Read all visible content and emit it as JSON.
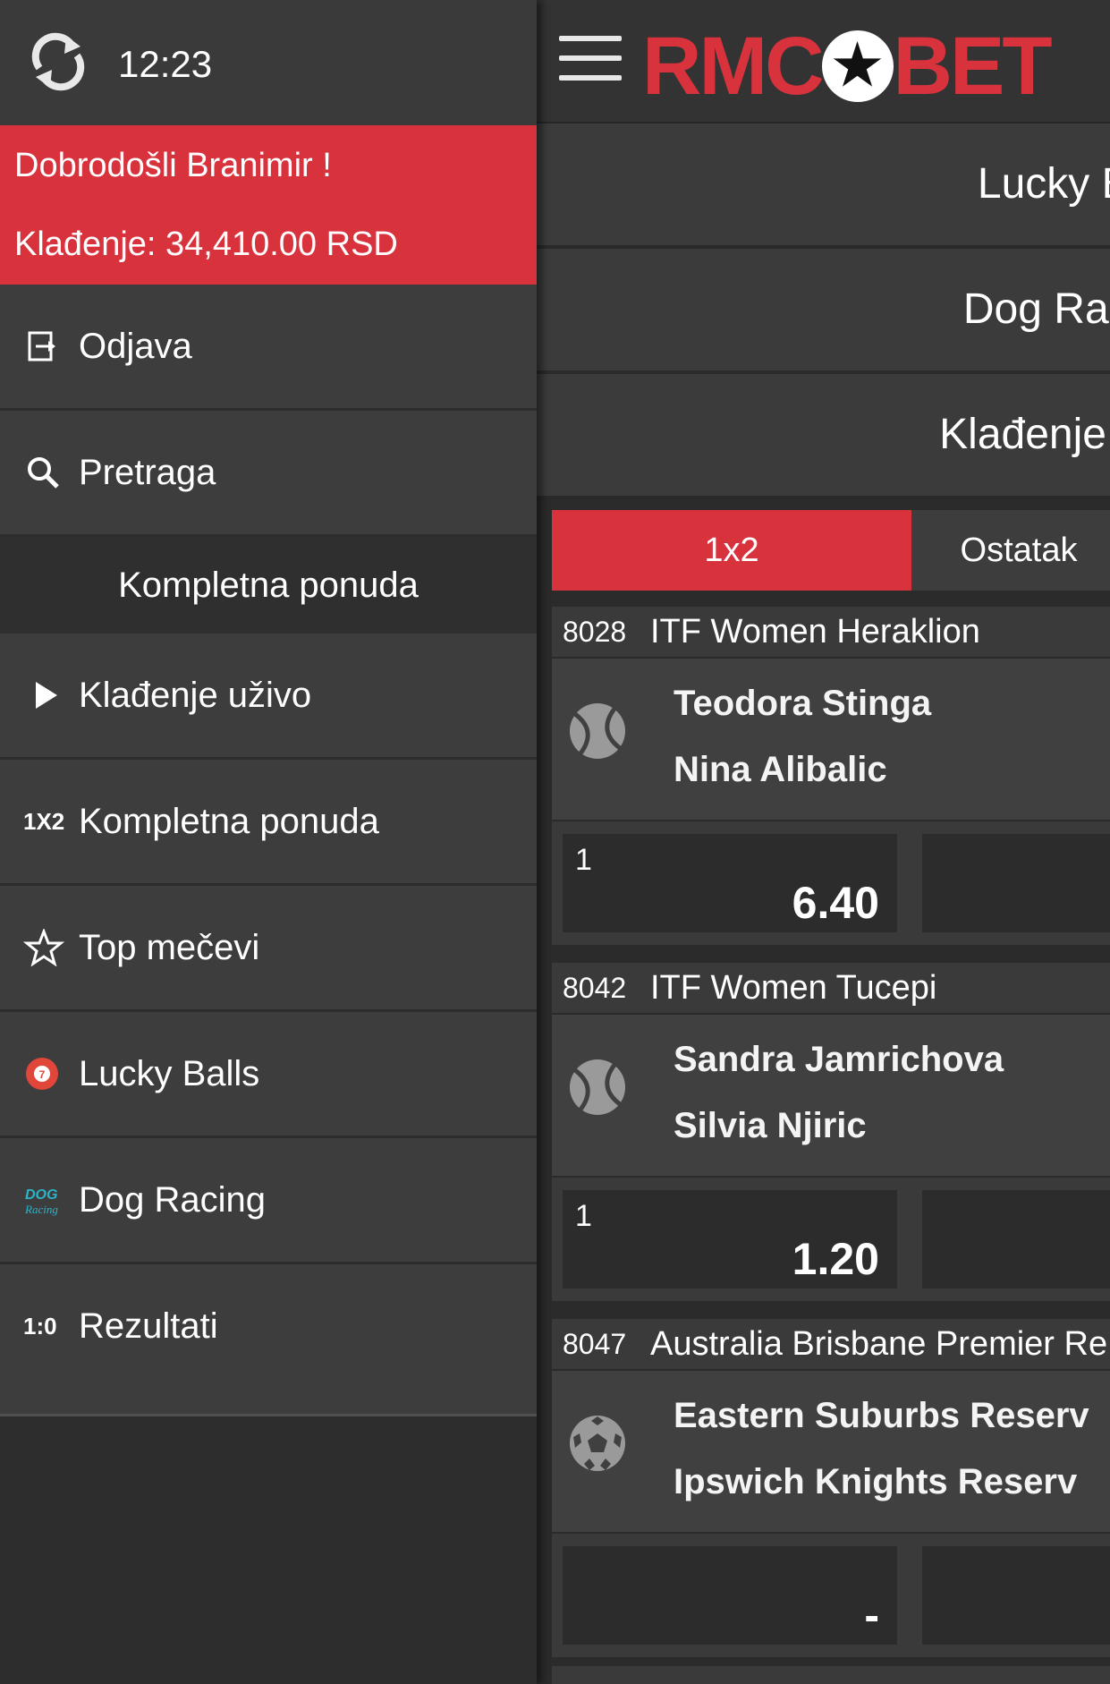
{
  "status": {
    "time": "12:23"
  },
  "drawer": {
    "welcome": "Dobrodošli Branimir !",
    "balance": "Klađenje: 34,410.00 RSD",
    "section_title": "Kompletna ponuda",
    "items": [
      {
        "label": "Odjava",
        "icon": "logout-icon"
      },
      {
        "label": "Pretraga",
        "icon": "search-icon"
      },
      {
        "label": "Klađenje uživo",
        "icon": "play-icon"
      },
      {
        "label": "Kompletna ponuda",
        "icon": "1x2-icon"
      },
      {
        "label": "Top mečevi",
        "icon": "star-icon"
      },
      {
        "label": "Lucky Balls",
        "icon": "lucky-balls-icon"
      },
      {
        "label": "Dog Racing",
        "icon": "dog-racing-icon"
      },
      {
        "label": "Rezultati",
        "icon": "score-icon"
      }
    ],
    "icon_text": {
      "x12": "1X2",
      "score": "1:0"
    }
  },
  "header": {
    "logo": {
      "part1": "RMC",
      "ball": "★",
      "part2": "BET"
    },
    "brand_red": "#d8323d"
  },
  "games": [
    "Lucky Bal",
    "Dog Racin",
    "Klađenje už"
  ],
  "tabs": [
    "1x2",
    "Ostatak"
  ],
  "matches": [
    {
      "id": "8028",
      "league": "ITF Women Heraklion",
      "home": "Teodora Stinga",
      "away": "Nina Alibalic",
      "sport": "tennis-ball-icon",
      "odd_label": "1",
      "odd": "6.40"
    },
    {
      "id": "8042",
      "league": "ITF Women Tucepi",
      "home": "Sandra Jamrichova",
      "away": "Silvia Njiric",
      "sport": "tennis-ball-icon",
      "odd_label": "1",
      "odd": "1.20"
    },
    {
      "id": "8047",
      "league": "Australia Brisbane Premier Re",
      "home": "Eastern Suburbs Reserv",
      "away": "Ipswich Knights Reserv",
      "sport": "soccer-ball-icon",
      "odd_label": "",
      "odd": "-"
    }
  ]
}
